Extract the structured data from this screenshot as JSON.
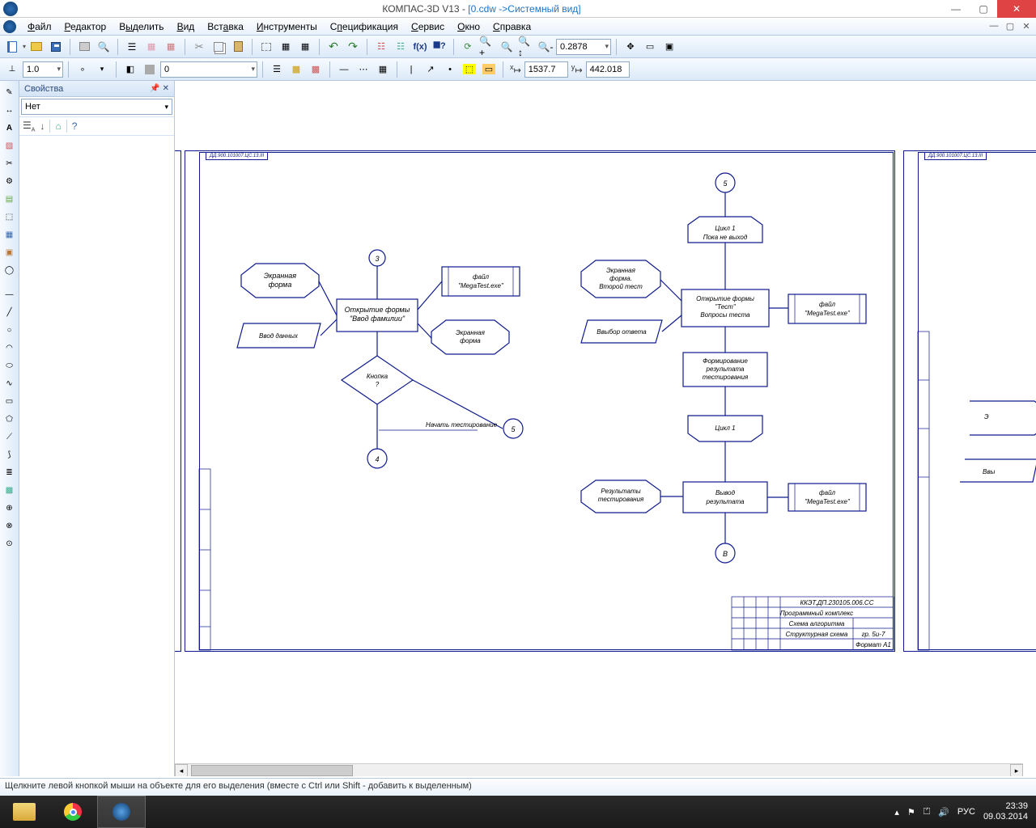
{
  "window": {
    "app": "КОМПАС-3D V13",
    "doc": "[0.cdw ->Системный вид]"
  },
  "menu": [
    "Файл",
    "Редактор",
    "Выделить",
    "Вид",
    "Вставка",
    "Инструменты",
    "Спецификация",
    "Сервис",
    "Окно",
    "Справка"
  ],
  "toolbar1": {
    "combo1": "",
    "combo_width": ""
  },
  "toolbar2": {
    "zoom_pct": "0.2878",
    "scale": "1.0",
    "layer": "0",
    "xcoord": "1537.7",
    "ycoord": "442.018"
  },
  "panel": {
    "title": "Свойства",
    "combo": "Нет"
  },
  "flow": {
    "c3": "3",
    "c5a": "5",
    "c5b": "5",
    "c4": "4",
    "cB": "В",
    "ekran1": "Экранная\nформа",
    "vvod": "Ввод данных",
    "open_fam": "Открытие формы\n\"Ввод фамилии\"",
    "file1": "файл\n\"MegaTest.exe\"",
    "ekran2": "Экранная\nформа",
    "knopka": "Кнопка\n?",
    "nachat": "Начать тестирование",
    "ekran3": "Экранная\nформа.\nВторой тест",
    "cycle_head": "Цикл 1\nПока не выход",
    "open_test": "Открытие формы\n\"Тест\"\nВопросы теста",
    "file2": "файл\n\"MegaTest.exe\"",
    "vybor": "Ввыбор ответа",
    "forming": "Формирование\nрезультата\nтестирования",
    "cycle_end": "Цикл 1",
    "rezult": "Результаты\nтестирования",
    "vyvod": "Вывод\nрезультата",
    "file3": "файл\n\"MegaTest.exe\"",
    "partial_ekr": "Э",
    "partial_vy": "Ввы",
    "stamp_code": "ККЭТ.ДП.230105.006.СС",
    "stamp_l1": "Программный комплекс",
    "stamp_l2": "Схема алгоритма",
    "stamp_l3": "Структурная схема",
    "stamp_scale": "гр. 5и-7",
    "stamp_fmt": "Формат А1"
  },
  "status": "Щелкните левой кнопкой мыши на объекте для его выделения (вместе с Ctrl или Shift - добавить к выделенным)",
  "tray": {
    "lang": "РУС",
    "time": "23:39",
    "date": "09.03.2014"
  }
}
